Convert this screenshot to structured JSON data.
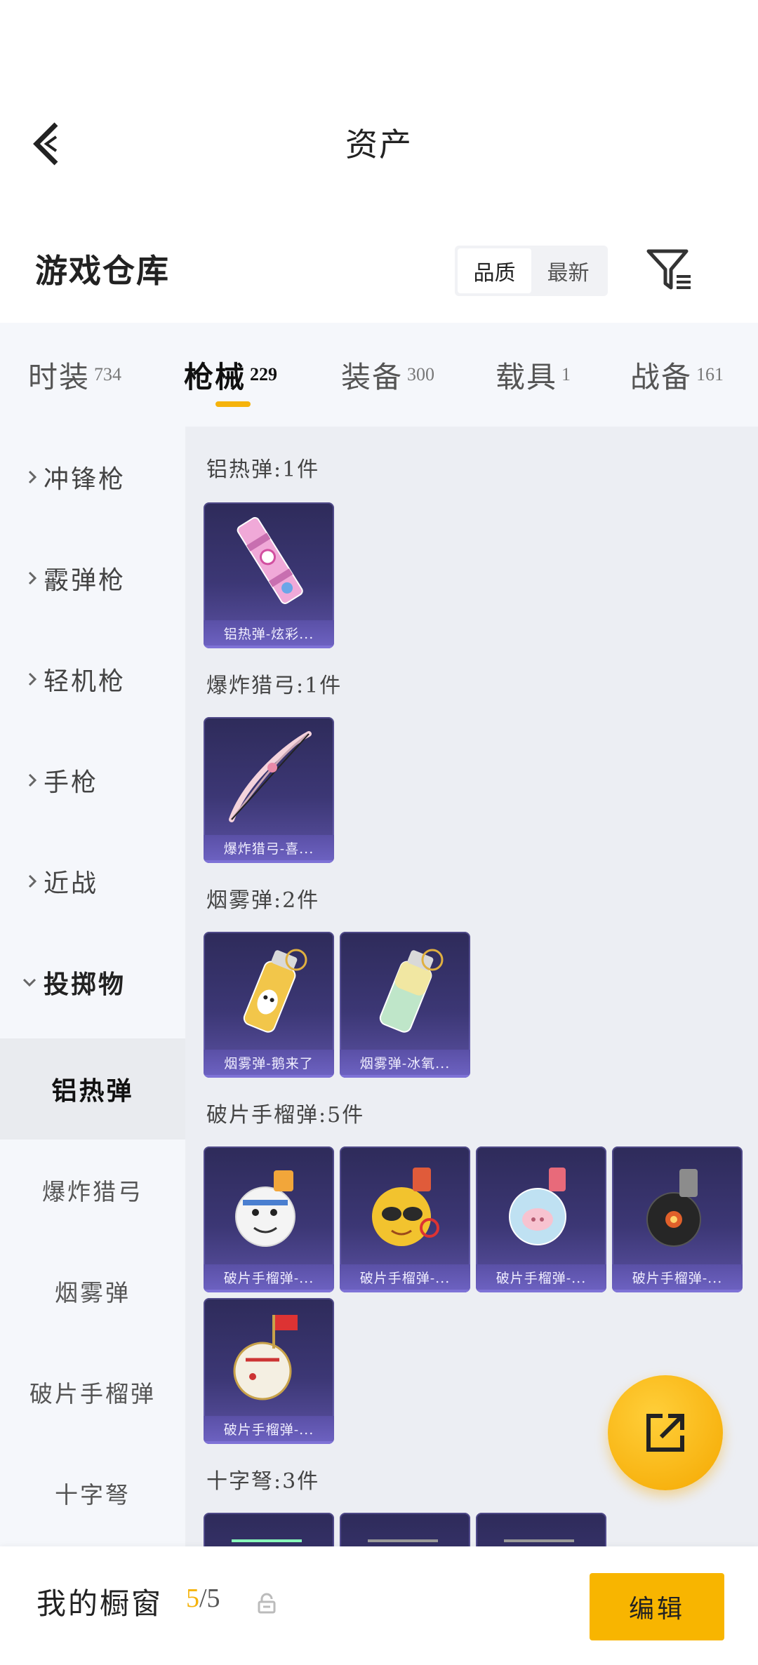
{
  "header": {
    "title": "资产"
  },
  "section": {
    "title": "游戏仓库",
    "sort_options": [
      "品质",
      "最新"
    ],
    "active_sort": "品质"
  },
  "tabs": [
    {
      "label": "时装",
      "count": "734"
    },
    {
      "label": "枪械",
      "count": "229"
    },
    {
      "label": "装备",
      "count": "300"
    },
    {
      "label": "载具",
      "count": "1"
    },
    {
      "label": "战备",
      "count": "161"
    }
  ],
  "active_tab": "枪械",
  "sidebar": {
    "categories": [
      {
        "label": "冲锋枪"
      },
      {
        "label": "霰弹枪"
      },
      {
        "label": "轻机枪"
      },
      {
        "label": "手枪"
      },
      {
        "label": "近战"
      },
      {
        "label": "投掷物"
      }
    ],
    "subcategories": [
      {
        "label": "铝热弹"
      },
      {
        "label": "爆炸猎弓"
      },
      {
        "label": "烟雾弹"
      },
      {
        "label": "破片手榴弹"
      },
      {
        "label": "十字弩"
      }
    ],
    "active_sub": "铝热弹"
  },
  "groups": [
    {
      "label": "铝热弹:1件",
      "items": [
        {
          "name": "铝热弹-炫彩...",
          "icon": "thermite-grenade-icon"
        }
      ]
    },
    {
      "label": "爆炸猎弓:1件",
      "items": [
        {
          "name": "爆炸猎弓-喜...",
          "icon": "bow-icon"
        }
      ]
    },
    {
      "label": "烟雾弹:2件",
      "items": [
        {
          "name": "烟雾弹-鹅来了",
          "icon": "smoke-grenade-penguin-icon"
        },
        {
          "name": "烟雾弹-冰氧...",
          "icon": "smoke-grenade-green-icon"
        }
      ]
    },
    {
      "label": "破片手榴弹:5件",
      "items": [
        {
          "name": "破片手榴弹-...",
          "icon": "frag-grenade-snowman-icon"
        },
        {
          "name": "破片手榴弹-...",
          "icon": "frag-grenade-sunglasses-icon"
        },
        {
          "name": "破片手榴弹-...",
          "icon": "frag-grenade-pig-icon"
        },
        {
          "name": "破片手榴弹-...",
          "icon": "frag-grenade-black-icon"
        },
        {
          "name": "破片手榴弹-...",
          "icon": "frag-grenade-flag-icon"
        }
      ]
    },
    {
      "label": "十字弩:3件",
      "items": [
        {
          "name": "",
          "icon": "crossbow-icon"
        },
        {
          "name": "",
          "icon": "crossbow-icon"
        },
        {
          "name": "",
          "icon": "crossbow-icon"
        }
      ]
    }
  ],
  "showcase": {
    "label": "我的橱窗",
    "current": "5",
    "total": "/5"
  },
  "edit_button": "编辑",
  "colors": {
    "accent": "#f5b30c",
    "card_bg": "#3c3775",
    "card_caption": "#6c61c0"
  }
}
